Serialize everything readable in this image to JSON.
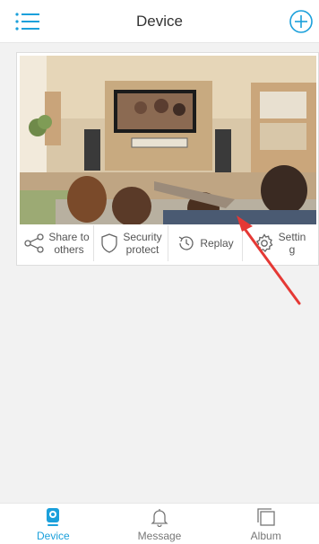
{
  "header": {
    "title": "Device",
    "menu_icon": "list-menu-icon",
    "add_icon": "add-circle-icon"
  },
  "device": {
    "camera_view": "living-room-camera-thumbnail",
    "actions": [
      {
        "label": "Share to\nothers",
        "icon": "share-icon"
      },
      {
        "label": "Security\nprotect",
        "icon": "shield-icon"
      },
      {
        "label": "Replay",
        "icon": "history-clock-icon"
      },
      {
        "label": "Settin\ng",
        "icon": "gear-icon"
      }
    ]
  },
  "tabbar": {
    "tabs": [
      {
        "label": "Device",
        "icon": "camera-icon",
        "active": true
      },
      {
        "label": "Message",
        "icon": "bell-icon",
        "active": false
      },
      {
        "label": "Album",
        "icon": "album-icon",
        "active": false
      }
    ]
  },
  "colors": {
    "accent": "#1ba0db",
    "arrow": "#e53935",
    "tab_inactive": "#777777"
  }
}
